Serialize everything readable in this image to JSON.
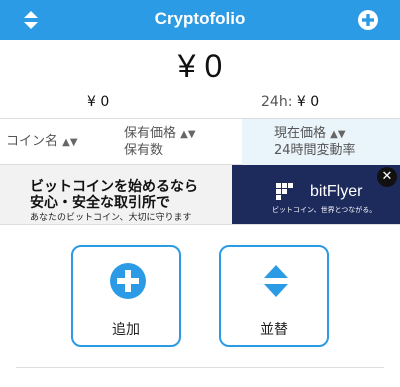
{
  "header": {
    "title": "Cryptofolio",
    "left_icon": "sort-arrows-icon",
    "right_icon": "add-circle-icon"
  },
  "summary": {
    "total": "¥ 0",
    "holding_value": "¥ 0",
    "change_label": "24h:",
    "change_value": "¥ 0"
  },
  "columns": {
    "coin_name": "コイン名",
    "holding_price": "保有価格",
    "holding_qty": "保有数",
    "current_price": "現在価格",
    "change_24h": "24時間変動率"
  },
  "ad": {
    "headline1": "ビットコインを始めるなら",
    "headline2": "安心・安全な取引所で",
    "subline": "あなたのビットコイン、大切に守ります",
    "brand": "bitFlyer",
    "brand_tagline": "ビットコイン、世界とつながる。",
    "close": "✕"
  },
  "actions": {
    "add_label": "追加",
    "sort_label": "並替"
  },
  "colors": {
    "accent": "#2b9be6",
    "header_bg": "#2b9be6",
    "ad_brand_bg": "#1d2a5c"
  }
}
